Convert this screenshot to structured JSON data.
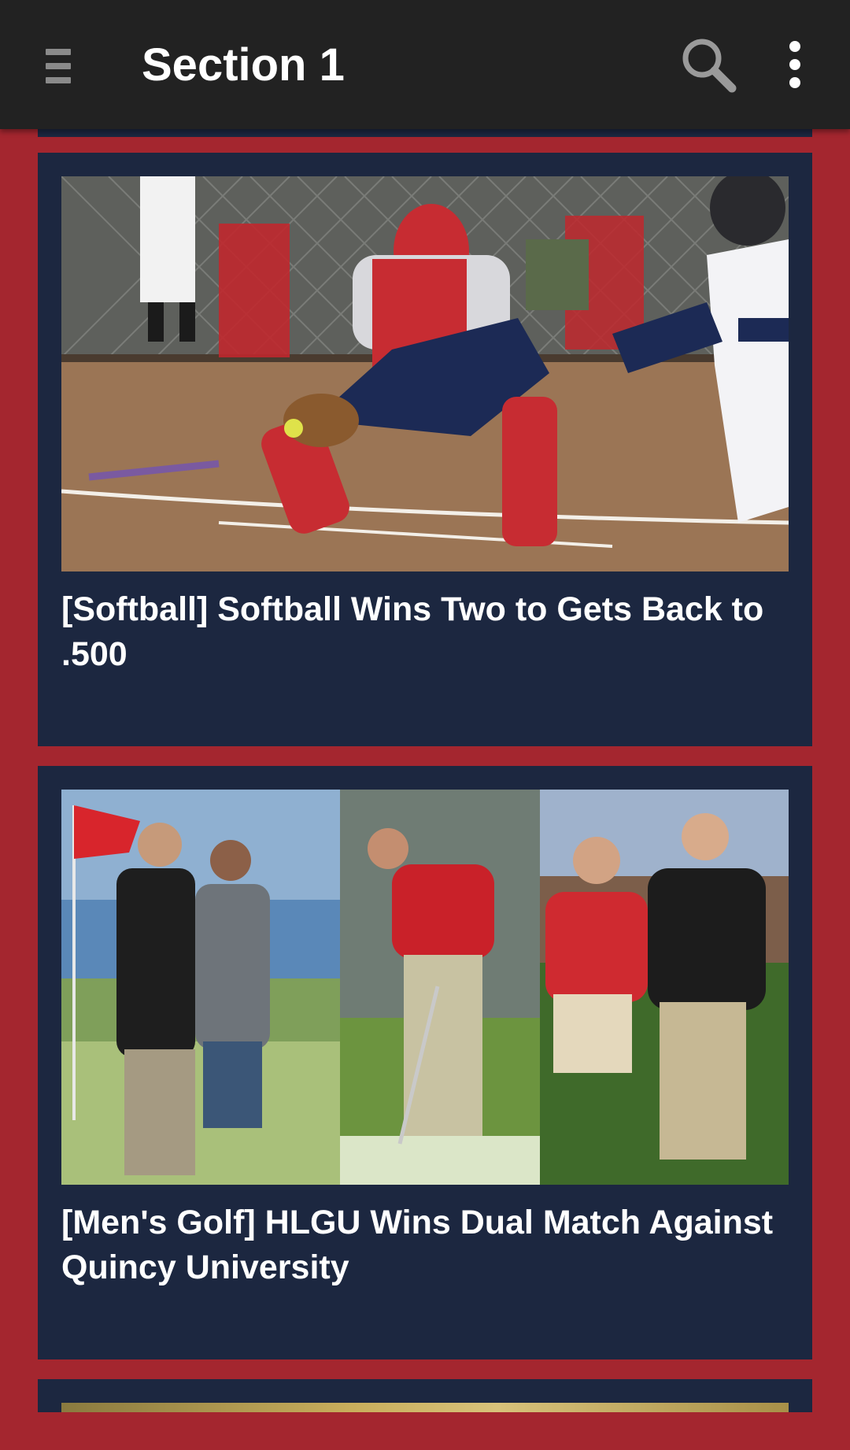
{
  "app_bar": {
    "title": "Section 1",
    "menu_icon": "hamburger-menu-icon",
    "search_icon": "search-icon",
    "overflow_icon": "more-vert-icon",
    "background_color": "#222222"
  },
  "theme": {
    "page_background": "#a4262f",
    "card_background": "#1c2740",
    "headline_color": "#ffffff"
  },
  "articles": [
    {
      "headline": "[Softball] Softball Wins Two to Gets Back to .500",
      "image_alt": "softball catcher fielding ball at home plate"
    },
    {
      "headline": "[Men's Golf] HLGU Wins Dual Match Against Quincy University",
      "image_alt": "collage of golfers on a golf course"
    },
    {
      "headline": "",
      "image_alt": "partially visible article image"
    }
  ]
}
